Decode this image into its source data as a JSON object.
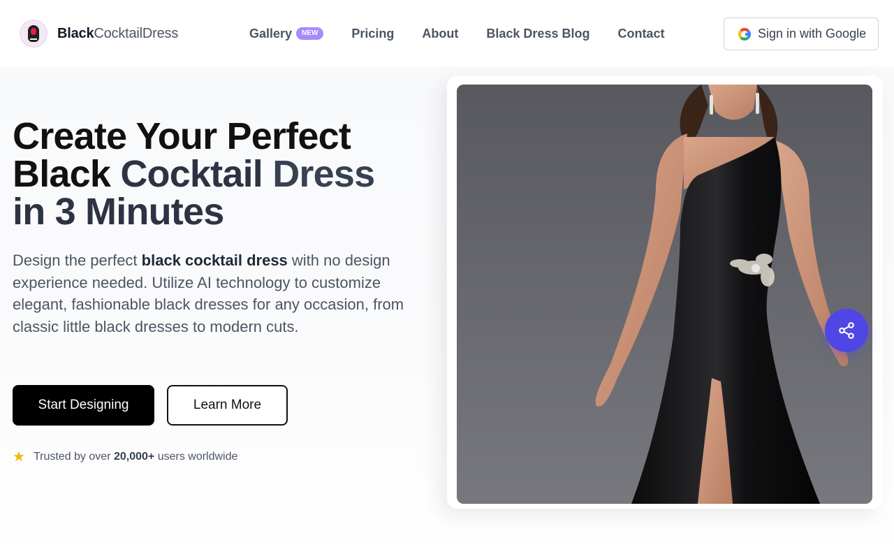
{
  "brand": {
    "name_bold": "Black",
    "name_light": "CocktailDress",
    "logo_icon": "dress-avatar-icon"
  },
  "nav": {
    "items": [
      {
        "label": "Gallery",
        "badge": "NEW"
      },
      {
        "label": "Pricing"
      },
      {
        "label": "About"
      },
      {
        "label": "Black Dress Blog"
      },
      {
        "label": "Contact"
      }
    ]
  },
  "auth": {
    "signin_label": "Sign in with Google",
    "icon": "google-icon"
  },
  "hero": {
    "headline": {
      "line1": "Create Your Perfect",
      "line2_a": "Black ",
      "line2_b": "Cocktail ",
      "line2_c": "Dress",
      "line3": "in 3 Minutes"
    },
    "lead": {
      "pre": "Design the perfect ",
      "bold": "black cocktail dress",
      "post": " with no design experience needed. Utilize AI technology to customize elegant, fashionable black dresses for any occasion, from classic little black dresses to modern cuts."
    },
    "primary_cta": "Start Designing",
    "secondary_cta": "Learn More",
    "trust": {
      "pre": "Trusted by over ",
      "count": "20,000+",
      "post": " users worldwide",
      "icon": "star-icon"
    }
  },
  "showcase": {
    "image_alt": "Model wearing one-shoulder black satin gown with embellished waist",
    "share_icon": "share-icon"
  },
  "colors": {
    "accent": "#4f46e5",
    "badge": "#a78bfa",
    "primary_button": "#000000",
    "star": "#f5b50a"
  }
}
